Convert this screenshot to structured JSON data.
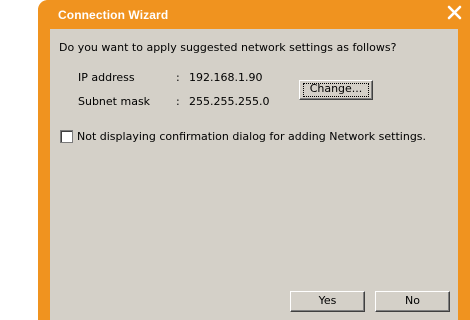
{
  "window": {
    "title": "Connection Wizard",
    "close_icon": "close-icon",
    "accent_color": "#f0931f"
  },
  "content": {
    "prompt": "Do you want to apply suggested network settings as follows?",
    "ip_label": "IP address",
    "ip_colon": ":",
    "ip_value": "192.168.1.90",
    "mask_label": "Subnet mask",
    "mask_colon": ":",
    "mask_value": "255.255.255.0",
    "change_label": "Change...",
    "checkbox_label": "Not displaying confirmation dialog for adding Network settings.",
    "checkbox_checked": false
  },
  "footer": {
    "yes_label": "Yes",
    "no_label": "No"
  }
}
